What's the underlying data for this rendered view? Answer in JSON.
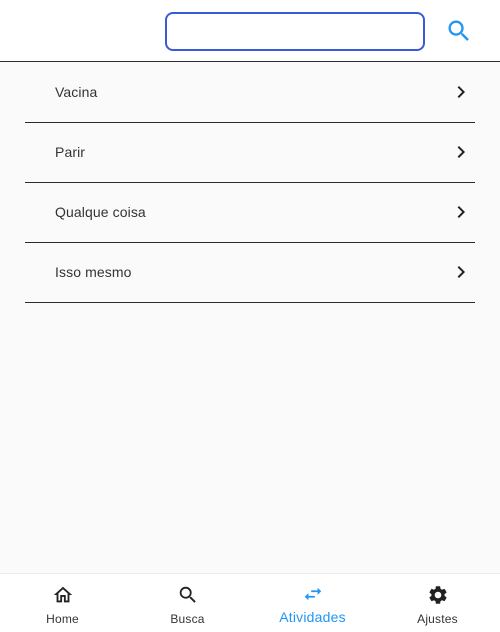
{
  "search": {
    "value": "",
    "placeholder": "",
    "icon": "search-icon"
  },
  "list": {
    "items": [
      {
        "label": "Vacina",
        "icon": "chevron-right-icon"
      },
      {
        "label": "Parir",
        "icon": "chevron-right-icon"
      },
      {
        "label": "Qualque coisa",
        "icon": "chevron-right-icon"
      },
      {
        "label": "Isso mesmo",
        "icon": "chevron-right-icon"
      }
    ]
  },
  "bottom_nav": {
    "items": [
      {
        "label": "Home",
        "icon": "home-icon",
        "active": false
      },
      {
        "label": "Busca",
        "icon": "search-icon",
        "active": false
      },
      {
        "label": "Atividades",
        "icon": "swap-arrows-icon",
        "active": true
      },
      {
        "label": "Ajustes",
        "icon": "gear-icon",
        "active": false
      }
    ]
  },
  "colors": {
    "accent": "#2196f3",
    "search_border": "#3a5bd6",
    "divider": "#2c2c2c",
    "text": "#333333"
  }
}
